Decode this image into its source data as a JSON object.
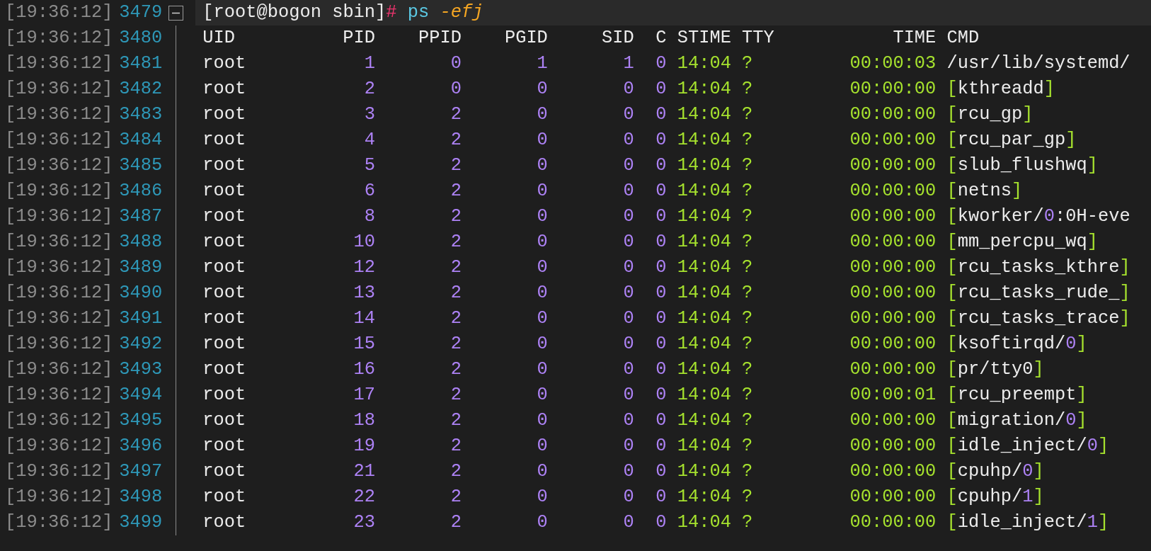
{
  "prompt_line": {
    "timestamp": "[19:36:12]",
    "line_number": "3479",
    "fold": {
      "expanded": true
    },
    "prompt": "[root@bogon sbin]",
    "prompt_symbol": "#",
    "command": "ps",
    "args": "-efj"
  },
  "header_line": {
    "timestamp": "[19:36:12]",
    "line_number": "3480",
    "columns": [
      "UID",
      "PID",
      "PPID",
      "PGID",
      "SID",
      "C",
      "STIME",
      "TTY",
      "TIME",
      "CMD"
    ]
  },
  "rows": [
    {
      "timestamp": "[19:36:12]",
      "line_number": "3481",
      "uid": "root",
      "pid": "1",
      "ppid": "0",
      "pgid": "1",
      "sid": "1",
      "c": "0",
      "stime": "14:04",
      "tty": "?",
      "time": "00:00:03",
      "cmd": [
        {
          "text": "/usr/lib/systemd/",
          "kind": "text"
        }
      ]
    },
    {
      "timestamp": "[19:36:12]",
      "line_number": "3482",
      "uid": "root",
      "pid": "2",
      "ppid": "0",
      "pgid": "0",
      "sid": "0",
      "c": "0",
      "stime": "14:04",
      "tty": "?",
      "time": "00:00:00",
      "cmd": [
        {
          "text": "[",
          "kind": "bracket"
        },
        {
          "text": "kthreadd",
          "kind": "text"
        },
        {
          "text": "]",
          "kind": "bracket"
        }
      ]
    },
    {
      "timestamp": "[19:36:12]",
      "line_number": "3483",
      "uid": "root",
      "pid": "3",
      "ppid": "2",
      "pgid": "0",
      "sid": "0",
      "c": "0",
      "stime": "14:04",
      "tty": "?",
      "time": "00:00:00",
      "cmd": [
        {
          "text": "[",
          "kind": "bracket"
        },
        {
          "text": "rcu_gp",
          "kind": "text"
        },
        {
          "text": "]",
          "kind": "bracket"
        }
      ]
    },
    {
      "timestamp": "[19:36:12]",
      "line_number": "3484",
      "uid": "root",
      "pid": "4",
      "ppid": "2",
      "pgid": "0",
      "sid": "0",
      "c": "0",
      "stime": "14:04",
      "tty": "?",
      "time": "00:00:00",
      "cmd": [
        {
          "text": "[",
          "kind": "bracket"
        },
        {
          "text": "rcu_par_gp",
          "kind": "text"
        },
        {
          "text": "]",
          "kind": "bracket"
        }
      ]
    },
    {
      "timestamp": "[19:36:12]",
      "line_number": "3485",
      "uid": "root",
      "pid": "5",
      "ppid": "2",
      "pgid": "0",
      "sid": "0",
      "c": "0",
      "stime": "14:04",
      "tty": "?",
      "time": "00:00:00",
      "cmd": [
        {
          "text": "[",
          "kind": "bracket"
        },
        {
          "text": "slub_flushwq",
          "kind": "text"
        },
        {
          "text": "]",
          "kind": "bracket"
        }
      ]
    },
    {
      "timestamp": "[19:36:12]",
      "line_number": "3486",
      "uid": "root",
      "pid": "6",
      "ppid": "2",
      "pgid": "0",
      "sid": "0",
      "c": "0",
      "stime": "14:04",
      "tty": "?",
      "time": "00:00:00",
      "cmd": [
        {
          "text": "[",
          "kind": "bracket"
        },
        {
          "text": "netns",
          "kind": "text"
        },
        {
          "text": "]",
          "kind": "bracket"
        }
      ]
    },
    {
      "timestamp": "[19:36:12]",
      "line_number": "3487",
      "uid": "root",
      "pid": "8",
      "ppid": "2",
      "pgid": "0",
      "sid": "0",
      "c": "0",
      "stime": "14:04",
      "tty": "?",
      "time": "00:00:00",
      "cmd": [
        {
          "text": "[",
          "kind": "bracket"
        },
        {
          "text": "kworker/",
          "kind": "text"
        },
        {
          "text": "0",
          "kind": "number"
        },
        {
          "text": ":0H-eve",
          "kind": "text"
        }
      ]
    },
    {
      "timestamp": "[19:36:12]",
      "line_number": "3488",
      "uid": "root",
      "pid": "10",
      "ppid": "2",
      "pgid": "0",
      "sid": "0",
      "c": "0",
      "stime": "14:04",
      "tty": "?",
      "time": "00:00:00",
      "cmd": [
        {
          "text": "[",
          "kind": "bracket"
        },
        {
          "text": "mm_percpu_wq",
          "kind": "text"
        },
        {
          "text": "]",
          "kind": "bracket"
        }
      ]
    },
    {
      "timestamp": "[19:36:12]",
      "line_number": "3489",
      "uid": "root",
      "pid": "12",
      "ppid": "2",
      "pgid": "0",
      "sid": "0",
      "c": "0",
      "stime": "14:04",
      "tty": "?",
      "time": "00:00:00",
      "cmd": [
        {
          "text": "[",
          "kind": "bracket"
        },
        {
          "text": "rcu_tasks_kthre",
          "kind": "text"
        },
        {
          "text": "]",
          "kind": "bracket"
        }
      ]
    },
    {
      "timestamp": "[19:36:12]",
      "line_number": "3490",
      "uid": "root",
      "pid": "13",
      "ppid": "2",
      "pgid": "0",
      "sid": "0",
      "c": "0",
      "stime": "14:04",
      "tty": "?",
      "time": "00:00:00",
      "cmd": [
        {
          "text": "[",
          "kind": "bracket"
        },
        {
          "text": "rcu_tasks_rude_",
          "kind": "text"
        },
        {
          "text": "]",
          "kind": "bracket"
        }
      ]
    },
    {
      "timestamp": "[19:36:12]",
      "line_number": "3491",
      "uid": "root",
      "pid": "14",
      "ppid": "2",
      "pgid": "0",
      "sid": "0",
      "c": "0",
      "stime": "14:04",
      "tty": "?",
      "time": "00:00:00",
      "cmd": [
        {
          "text": "[",
          "kind": "bracket"
        },
        {
          "text": "rcu_tasks_trace",
          "kind": "text"
        },
        {
          "text": "]",
          "kind": "bracket"
        }
      ]
    },
    {
      "timestamp": "[19:36:12]",
      "line_number": "3492",
      "uid": "root",
      "pid": "15",
      "ppid": "2",
      "pgid": "0",
      "sid": "0",
      "c": "0",
      "stime": "14:04",
      "tty": "?",
      "time": "00:00:00",
      "cmd": [
        {
          "text": "[",
          "kind": "bracket"
        },
        {
          "text": "ksoftirqd/",
          "kind": "text"
        },
        {
          "text": "0",
          "kind": "number"
        },
        {
          "text": "]",
          "kind": "bracket"
        }
      ]
    },
    {
      "timestamp": "[19:36:12]",
      "line_number": "3493",
      "uid": "root",
      "pid": "16",
      "ppid": "2",
      "pgid": "0",
      "sid": "0",
      "c": "0",
      "stime": "14:04",
      "tty": "?",
      "time": "00:00:00",
      "cmd": [
        {
          "text": "[",
          "kind": "bracket"
        },
        {
          "text": "pr/tty0",
          "kind": "text"
        },
        {
          "text": "]",
          "kind": "bracket"
        }
      ]
    },
    {
      "timestamp": "[19:36:12]",
      "line_number": "3494",
      "uid": "root",
      "pid": "17",
      "ppid": "2",
      "pgid": "0",
      "sid": "0",
      "c": "0",
      "stime": "14:04",
      "tty": "?",
      "time": "00:00:01",
      "cmd": [
        {
          "text": "[",
          "kind": "bracket"
        },
        {
          "text": "rcu_preempt",
          "kind": "text"
        },
        {
          "text": "]",
          "kind": "bracket"
        }
      ]
    },
    {
      "timestamp": "[19:36:12]",
      "line_number": "3495",
      "uid": "root",
      "pid": "18",
      "ppid": "2",
      "pgid": "0",
      "sid": "0",
      "c": "0",
      "stime": "14:04",
      "tty": "?",
      "time": "00:00:00",
      "cmd": [
        {
          "text": "[",
          "kind": "bracket"
        },
        {
          "text": "migration/",
          "kind": "text"
        },
        {
          "text": "0",
          "kind": "number"
        },
        {
          "text": "]",
          "kind": "bracket"
        }
      ]
    },
    {
      "timestamp": "[19:36:12]",
      "line_number": "3496",
      "uid": "root",
      "pid": "19",
      "ppid": "2",
      "pgid": "0",
      "sid": "0",
      "c": "0",
      "stime": "14:04",
      "tty": "?",
      "time": "00:00:00",
      "cmd": [
        {
          "text": "[",
          "kind": "bracket"
        },
        {
          "text": "idle_inject/",
          "kind": "text"
        },
        {
          "text": "0",
          "kind": "number"
        },
        {
          "text": "]",
          "kind": "bracket"
        }
      ]
    },
    {
      "timestamp": "[19:36:12]",
      "line_number": "3497",
      "uid": "root",
      "pid": "21",
      "ppid": "2",
      "pgid": "0",
      "sid": "0",
      "c": "0",
      "stime": "14:04",
      "tty": "?",
      "time": "00:00:00",
      "cmd": [
        {
          "text": "[",
          "kind": "bracket"
        },
        {
          "text": "cpuhp/",
          "kind": "text"
        },
        {
          "text": "0",
          "kind": "number"
        },
        {
          "text": "]",
          "kind": "bracket"
        }
      ]
    },
    {
      "timestamp": "[19:36:12]",
      "line_number": "3498",
      "uid": "root",
      "pid": "22",
      "ppid": "2",
      "pgid": "0",
      "sid": "0",
      "c": "0",
      "stime": "14:04",
      "tty": "?",
      "time": "00:00:00",
      "cmd": [
        {
          "text": "[",
          "kind": "bracket"
        },
        {
          "text": "cpuhp/",
          "kind": "text"
        },
        {
          "text": "1",
          "kind": "number"
        },
        {
          "text": "]",
          "kind": "bracket"
        }
      ]
    },
    {
      "timestamp": "[19:36:12]",
      "line_number": "3499",
      "uid": "root",
      "pid": "23",
      "ppid": "2",
      "pgid": "0",
      "sid": "0",
      "c": "0",
      "stime": "14:04",
      "tty": "?",
      "time": "00:00:00",
      "cmd": [
        {
          "text": "[",
          "kind": "bracket"
        },
        {
          "text": "idle_inject/",
          "kind": "text"
        },
        {
          "text": "1",
          "kind": "number"
        },
        {
          "text": "]",
          "kind": "bracket"
        }
      ]
    }
  ]
}
